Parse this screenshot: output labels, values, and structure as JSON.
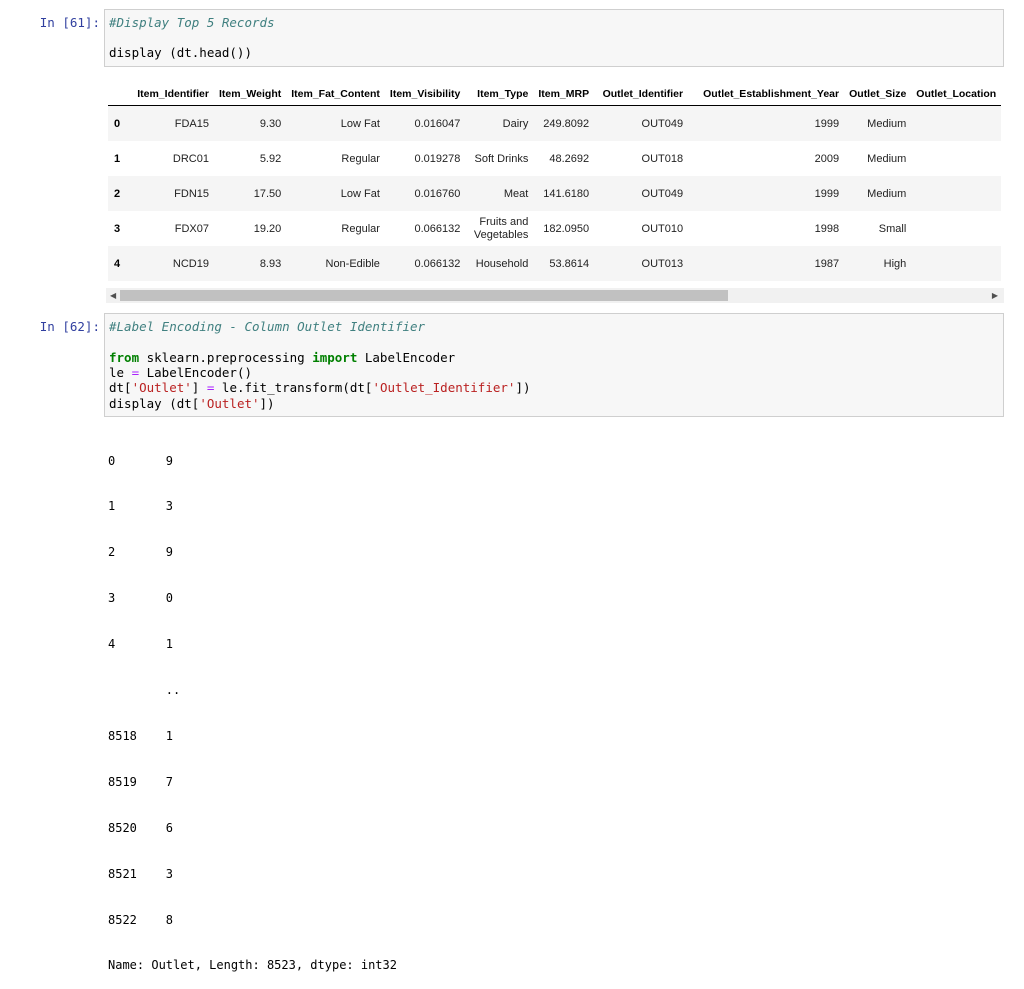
{
  "cell1": {
    "prompt": "In [61]:",
    "comment": "#Display Top 5 Records",
    "code": "display (dt.head())"
  },
  "table": {
    "columns": [
      "Item_Identifier",
      "Item_Weight",
      "Item_Fat_Content",
      "Item_Visibility",
      "Item_Type",
      "Item_MRP",
      "Outlet_Identifier",
      "Outlet_Establishment_Year",
      "Outlet_Size",
      "Outlet_Location"
    ],
    "rows": [
      {
        "index": "0",
        "cells": [
          "FDA15",
          "9.30",
          "Low Fat",
          "0.016047",
          "Dairy",
          "249.8092",
          "OUT049",
          "1999",
          "Medium",
          ""
        ]
      },
      {
        "index": "1",
        "cells": [
          "DRC01",
          "5.92",
          "Regular",
          "0.019278",
          "Soft Drinks",
          "48.2692",
          "OUT018",
          "2009",
          "Medium",
          ""
        ]
      },
      {
        "index": "2",
        "cells": [
          "FDN15",
          "17.50",
          "Low Fat",
          "0.016760",
          "Meat",
          "141.6180",
          "OUT049",
          "1999",
          "Medium",
          ""
        ]
      },
      {
        "index": "3",
        "cells": [
          "FDX07",
          "19.20",
          "Regular",
          "0.066132",
          "Fruits and Vegetables",
          "182.0950",
          "OUT010",
          "1998",
          "Small",
          ""
        ]
      },
      {
        "index": "4",
        "cells": [
          "NCD19",
          "8.93",
          "Non-Edible",
          "0.066132",
          "Household",
          "53.8614",
          "OUT013",
          "1987",
          "High",
          ""
        ]
      }
    ]
  },
  "cell2": {
    "prompt": "In [62]:",
    "comment": "#Label Encoding - Column Outlet Identifier",
    "line1": {
      "from": "from",
      "module": " sklearn.preprocessing ",
      "import": "import",
      "name": " LabelEncoder"
    },
    "line2": {
      "a": "le ",
      "eq": "=",
      "b": " LabelEncoder()"
    },
    "line3": {
      "a": "dt[",
      "s1": "'Outlet'",
      "b": "] ",
      "eq": "=",
      "c": " le.fit_transform(dt[",
      "s2": "'Outlet_Identifier'",
      "d": "])"
    },
    "line4": {
      "a": "display (dt[",
      "s1": "'Outlet'",
      "b": "])"
    }
  },
  "output": {
    "lines": [
      "0       9",
      "1       3",
      "2       9",
      "3       0",
      "4       1",
      "        ..",
      "8518    1",
      "8519    7",
      "8520    6",
      "8521    3",
      "8522    8"
    ],
    "footer": "Name: Outlet, Length: 8523, dtype: int32"
  }
}
